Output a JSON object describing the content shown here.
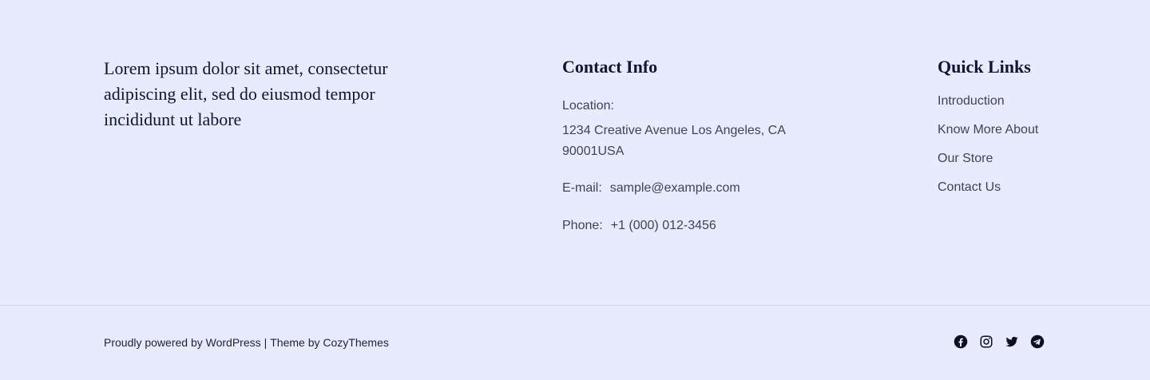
{
  "tagline": "Lorem ipsum dolor sit amet, consectetur adipiscing elit, sed do eiusmod tempor incididunt ut labore",
  "contact": {
    "title": "Contact Info",
    "location_label": "Location:",
    "location_value": "1234 Creative Avenue Los Angeles, CA 90001USA",
    "email_label": "E-mail:",
    "email_value": "sample@example.com",
    "phone_label": "Phone:",
    "phone_value": "+1 (000) 012-3456"
  },
  "quick_links": {
    "title": "Quick Links",
    "items": [
      {
        "label": "Introduction"
      },
      {
        "label": "Know More About"
      },
      {
        "label": "Our Store"
      },
      {
        "label": "Contact Us"
      }
    ]
  },
  "credits": {
    "powered_text": "Proudly powered by WordPress",
    "separator": "|",
    "theme_text": "Theme by CozyThemes"
  },
  "social": {
    "icons": [
      "facebook-icon",
      "instagram-icon",
      "twitter-icon",
      "telegram-icon"
    ]
  },
  "colors": {
    "background": "#e8ebfc",
    "heading": "#0f1533",
    "body_text": "#3f4354",
    "divider": "#d3d6e6"
  }
}
